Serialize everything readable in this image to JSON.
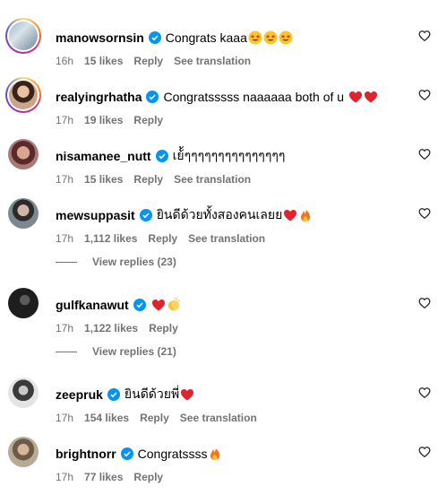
{
  "comments": [
    {
      "username": "manowsornsin",
      "text": "Congrats kaaa",
      "emojis": [
        "star-struck",
        "star-struck",
        "star-struck"
      ],
      "time": "16h",
      "likes": "15 likes",
      "reply": "Reply",
      "translate": "See translation"
    },
    {
      "username": "realyingrhatha",
      "text": "Congratsssss naaaaaa both of u",
      "emojis": [
        "red-heart",
        "red-heart"
      ],
      "time": "17h",
      "likes": "19 likes",
      "reply": "Reply",
      "translate": ""
    },
    {
      "username": "nisamanee_nutt",
      "text": "เย้้ๆๆๆๆๆๆๆๆๆๆๆๆๆๆๆ",
      "emojis": [],
      "time": "17h",
      "likes": "15 likes",
      "reply": "Reply",
      "translate": "See translation"
    },
    {
      "username": "mewsuppasit",
      "text": "ยินดีด้วยทั้งสองคนเลยย",
      "emojis": [
        "red-heart",
        "fire"
      ],
      "time": "17h",
      "likes": "1,112 likes",
      "reply": "Reply",
      "translate": "See translation"
    },
    {
      "username": "gulfkanawut",
      "text": "",
      "emojis": [
        "red-heart",
        "clapping-hands"
      ],
      "time": "17h",
      "likes": "1,122 likes",
      "reply": "Reply",
      "translate": ""
    },
    {
      "username": "zeepruk",
      "text": "ยินดีด้วยพี่",
      "emojis": [
        "red-heart"
      ],
      "time": "17h",
      "likes": "154 likes",
      "reply": "Reply",
      "translate": "See translation"
    },
    {
      "username": "brightnorr",
      "text": "Congratssss",
      "emojis": [
        "fire"
      ],
      "time": "17h",
      "likes": "77 likes",
      "reply": "Reply",
      "translate": ""
    }
  ],
  "view_replies": [
    "View replies (23)",
    "View replies (21)"
  ],
  "colors": {
    "verified": "#0095f6",
    "meta": "#737373",
    "heart": "#ed4956"
  }
}
